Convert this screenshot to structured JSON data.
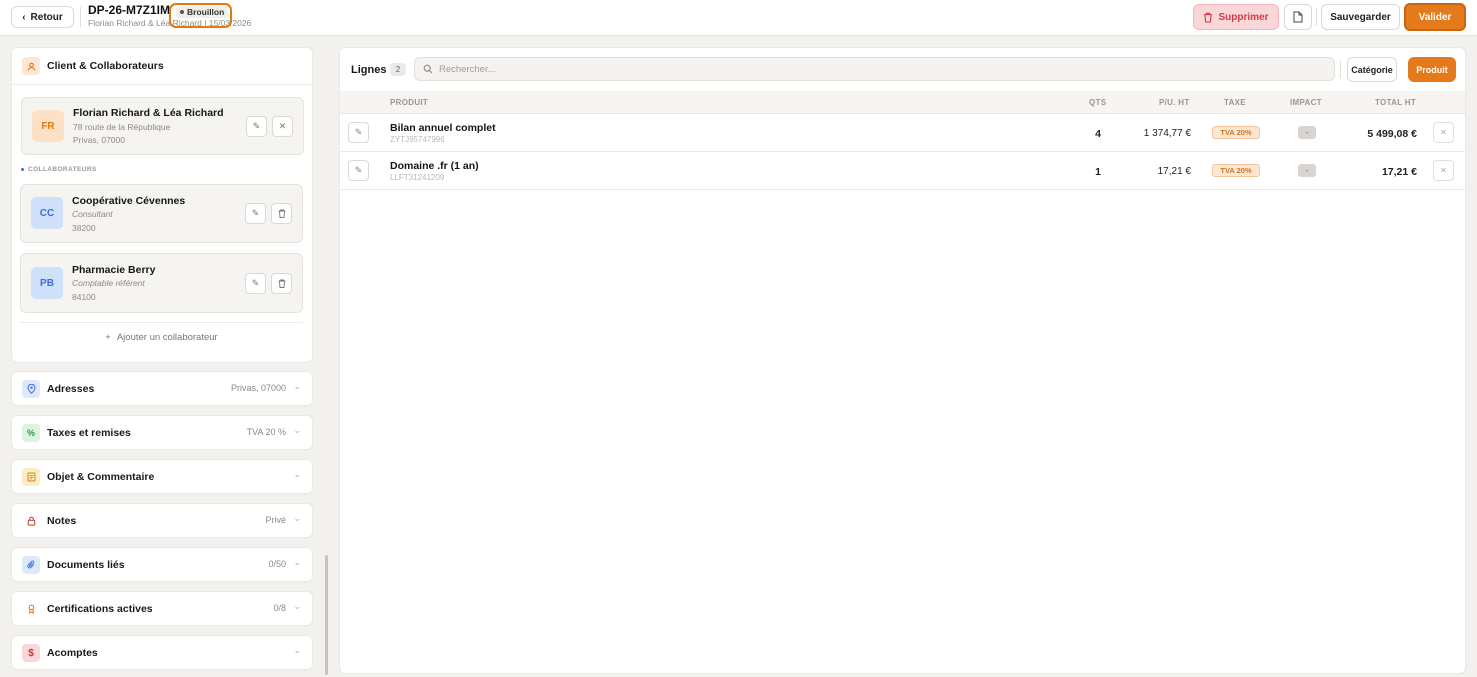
{
  "header": {
    "back_label": "Retour",
    "doc_number": "DP-26-M7Z1IM",
    "status": "Brouillon",
    "subtitle": "Florian Richard & Léa Richard | 15/03/2026",
    "delete_label": "Supprimer",
    "save_label": "Sauvegarder",
    "validate_label": "Valider"
  },
  "client": {
    "section_title": "Client & Collaborateurs",
    "main": {
      "initials": "FR",
      "name": "Florian Richard & Léa Richard",
      "address": "78 route de la République",
      "city": "Privas, 07000"
    },
    "collab_label": "COLLABORATEURS",
    "collaborators": [
      {
        "initials": "CC",
        "name": "Coopérative Cévennes",
        "role": "Consultant",
        "postal": "38200"
      },
      {
        "initials": "PB",
        "name": "Pharmacie Berry",
        "role": "Comptable référent",
        "postal": "84100"
      }
    ],
    "add_label": "Ajouter un collaborateur"
  },
  "sections": [
    {
      "title": "Adresses",
      "value": "Privas, 07000",
      "icon": "location-icon",
      "color": "#3a6fd8",
      "bg": "#dde8fb"
    },
    {
      "title": "Taxes et remises",
      "value": "TVA 20 %",
      "icon": "percent-icon",
      "color": "#2e9a4f",
      "bg": "#dcf3e2"
    },
    {
      "title": "Objet & Commentaire",
      "value": "",
      "icon": "note-icon",
      "color": "#c98a10",
      "bg": "#fcecc8"
    },
    {
      "title": "Notes",
      "value": "Privé",
      "icon": "lock-icon",
      "color": "#c0392b",
      "bg": "#ffffff"
    },
    {
      "title": "Documents liés",
      "value": "0/50",
      "icon": "paperclip-icon",
      "color": "#3a6fd8",
      "bg": "#dde8fb"
    },
    {
      "title": "Certifications actives",
      "value": "0/8",
      "icon": "award-icon",
      "color": "#d4731e",
      "bg": "#ffffff"
    },
    {
      "title": "Acomptes",
      "value": "",
      "icon": "dollar-icon",
      "color": "#c0392b",
      "bg": "#f9d6d8"
    }
  ],
  "lines": {
    "title": "Lignes",
    "count": "2",
    "search_placeholder": "Rechercher...",
    "category_label": "Catégorie",
    "product_label": "Produit",
    "columns": {
      "product": "PRODUIT",
      "qty": "QTS",
      "unit_price": "P/U. HT",
      "tax": "TAXE",
      "impact": "IMPACT",
      "total": "TOTAL HT"
    },
    "rows": [
      {
        "name": "Bilan annuel complet",
        "sku": "ZYTJ95747996",
        "qty": "4",
        "unit_price": "1 374,77 €",
        "tax": "TVA 20%",
        "impact": "-",
        "total": "5 499,08 €"
      },
      {
        "name": "Domaine .fr (1 an)",
        "sku": "LLFT31241209",
        "qty": "1",
        "unit_price": "17,21 €",
        "tax": "TVA 20%",
        "impact": "-",
        "total": "17,21 €"
      }
    ]
  }
}
